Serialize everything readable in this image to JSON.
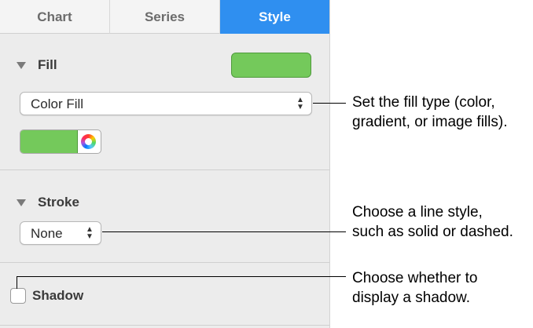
{
  "tabs": [
    {
      "label": "Chart",
      "active": false
    },
    {
      "label": "Series",
      "active": false
    },
    {
      "label": "Style",
      "active": true
    }
  ],
  "fill": {
    "title": "Fill",
    "swatch_color": "#74c95b",
    "type_value": "Color Fill",
    "well_color": "#74c95b"
  },
  "stroke": {
    "title": "Stroke",
    "value": "None"
  },
  "shadow": {
    "label": "Shadow",
    "checked": false
  },
  "callouts": {
    "fill_line1": "Set the fill type (color,",
    "fill_line2": "gradient, or image fills).",
    "stroke_line1": "Choose a line style,",
    "stroke_line2": "such as solid or dashed.",
    "shadow_line1": "Choose whether to",
    "shadow_line2": "display a shadow."
  },
  "colors": {
    "accent": "#2f8ff0",
    "panel": "#ececec",
    "fill_green": "#74c95b"
  },
  "icons": [
    "disclosure-triangle-icon",
    "color-wheel-icon",
    "up-down-arrows-icon"
  ]
}
